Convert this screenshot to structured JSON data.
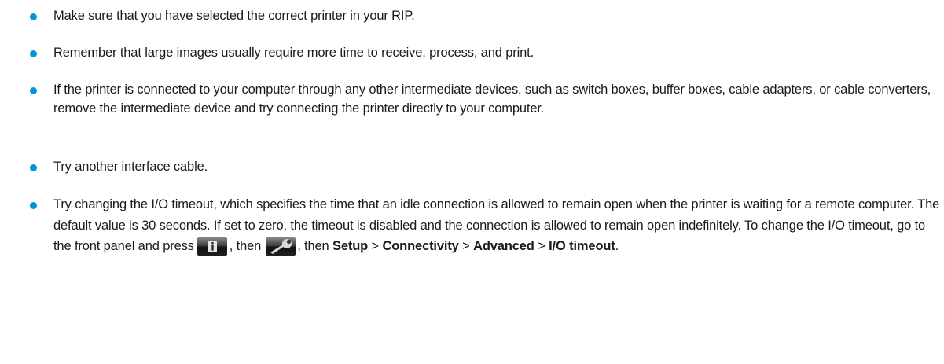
{
  "bullets": [
    {
      "text": "Make sure that you have selected the correct printer in your RIP."
    },
    {
      "text": "Remember that large images usually require more time to receive, process, and print."
    },
    {
      "text": "If the printer is connected to your computer through any other intermediate devices, such as switch boxes, buffer boxes, cable adapters, or cable converters, remove the intermediate device and try connecting the printer directly to your computer."
    },
    {
      "text": "Try another interface cable."
    },
    {
      "text_pre": "Try changing the I/O timeout, which specifies the time that an idle connection is allowed to remain open when the printer is waiting for a remote computer. The default value is 30 seconds. If set to zero, the timeout is disabled and the connection is allowed to remain open indefinitely. To change the I/O timeout, go to the front panel and press",
      "sep_then_1": ", then",
      "sep_then_2": ", then",
      "menu_setup": "Setup",
      "arrow_1": ">",
      "menu_connectivity": "Connectivity",
      "arrow_2": ">",
      "menu_advanced": "Advanced",
      "arrow_3": ">",
      "menu_io_timeout": "I/O timeout",
      "end_period": "."
    }
  ],
  "icons": {
    "info": "info-icon",
    "wrench": "wrench-icon"
  },
  "colors": {
    "bullet": "#0096d6",
    "text": "#1a1a1a"
  }
}
